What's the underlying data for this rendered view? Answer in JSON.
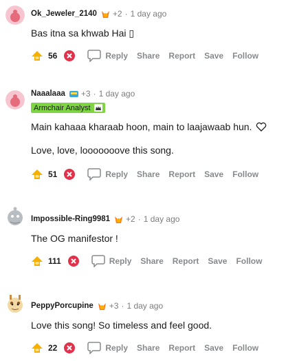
{
  "comments": [
    {
      "username": "Ok_Jeweler_2140",
      "award_count": "+2",
      "separator": "·",
      "time": "1 day ago",
      "flair": null,
      "body": [
        "Bas itna sa khwab Hai ▯"
      ],
      "score": "56",
      "avatar_icon": "pink-snoo-avatar-icon"
    },
    {
      "username": "Naaalaaa",
      "award_count": "+3",
      "separator": "·",
      "time": "1 day ago",
      "flair": "Armchair Analyst",
      "body": [
        "Main kahaaa kharaab hoon, main to laajawaab hun.",
        "Love, love, looooooove this song."
      ],
      "score": "51",
      "avatar_icon": "pink-snoo-avatar-icon"
    },
    {
      "username": "Impossible-Ring9981",
      "award_count": "+2",
      "separator": "·",
      "time": "1 day ago",
      "flair": null,
      "body": [
        "The OG manifestor !"
      ],
      "score": "111",
      "avatar_icon": "grey-snoo-avatar-icon"
    },
    {
      "username": "PeppyPorcupine",
      "award_count": "+3",
      "separator": "·",
      "time": "1 day ago",
      "flair": null,
      "body": [
        "Love this song! So timeless and feel good."
      ],
      "score": "22",
      "avatar_icon": "giraffe-snoo-avatar-icon"
    }
  ],
  "actions": {
    "reply": "Reply",
    "share": "Share",
    "report": "Report",
    "save": "Save",
    "follow": "Follow"
  },
  "colors": {
    "meta": "#7c7c7c",
    "action": "#878a8c",
    "flair_bg": "#7fd444",
    "upvote": "#f5b000",
    "downvote": "#e0324b"
  }
}
